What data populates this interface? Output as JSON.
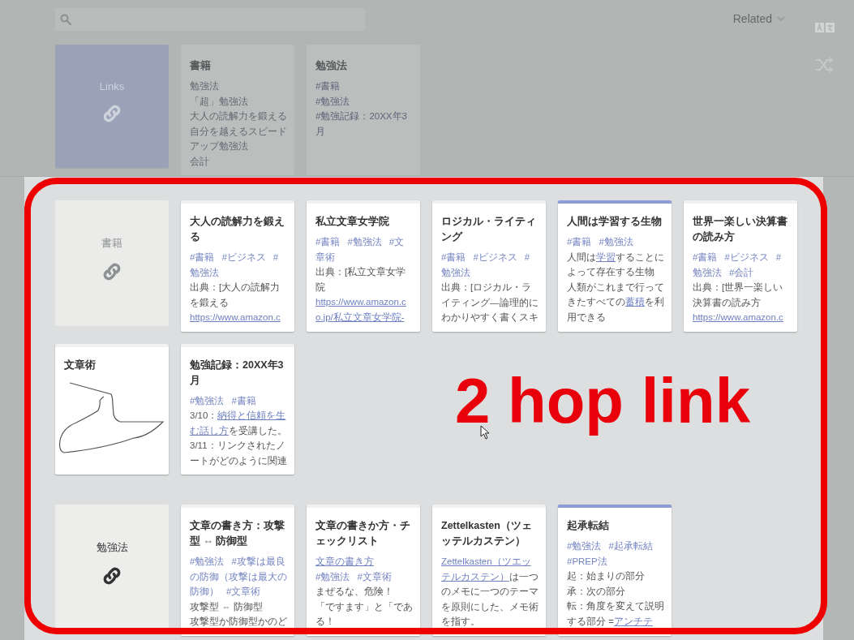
{
  "sort_menu": {
    "label": "Related"
  },
  "top_links": {
    "header": {
      "title": "Links",
      "kind": "links"
    },
    "cards": [
      {
        "title": "書籍",
        "kind": "text",
        "lines": [
          [
            {
              "text": "勉強法",
              "kind": "link"
            }
          ],
          [
            {
              "text": "「超」勉強法",
              "kind": "link"
            }
          ],
          [
            {
              "text": "大人の読解力を鍛える",
              "kind": "link"
            }
          ],
          [
            {
              "text": "自分を越えるスピード",
              "kind": "link"
            }
          ],
          [
            {
              "text": "アップ勉強法",
              "kind": "link"
            }
          ],
          [
            {
              "text": "会計",
              "kind": "link"
            }
          ]
        ]
      },
      {
        "title": "勉強法",
        "kind": "text",
        "lines": [
          [
            {
              "text": "#書籍",
              "kind": "tag"
            }
          ],
          [
            {
              "text": "#勉強法",
              "kind": "tag"
            }
          ],
          [
            {
              "text": "#勉強記録：20XX年3",
              "kind": "tag"
            }
          ],
          [
            {
              "text": "月",
              "kind": "tag"
            }
          ]
        ]
      }
    ]
  },
  "groups": [
    {
      "header": {
        "title": "書籍",
        "kind": "faded"
      },
      "cards": [
        {
          "title": "大人の読解力を鍛える",
          "highlighted": false,
          "kind": "text",
          "lines": [
            [
              {
                "text": "#書籍",
                "kind": "tag"
              },
              {
                "text": "#ビジネス",
                "kind": "tag"
              },
              {
                "text": "#",
                "kind": "tag"
              }
            ],
            [
              {
                "text": "勉強法",
                "kind": "tag"
              }
            ],
            [
              {
                "text": "出典：[大人の読解力",
                "kind": "text"
              }
            ],
            [
              {
                "text": "を鍛える",
                "kind": "text"
              }
            ],
            [
              {
                "text": "https://www.amazon.c",
                "kind": "link"
              }
            ]
          ]
        },
        {
          "title": "私立文章女学院",
          "highlighted": false,
          "kind": "text",
          "lines": [
            [
              {
                "text": "#書籍",
                "kind": "tag"
              },
              {
                "text": "#勉強法",
                "kind": "tag"
              },
              {
                "text": "#文",
                "kind": "tag"
              }
            ],
            [
              {
                "text": "章術",
                "kind": "tag"
              }
            ],
            [
              {
                "text": "出典：[私立文章女学",
                "kind": "text"
              }
            ],
            [
              {
                "text": "院",
                "kind": "text"
              }
            ],
            [
              {
                "text": "https://www.amazon.c",
                "kind": "link"
              }
            ],
            [
              {
                "text": "o.jp/私立文章女学院-",
                "kind": "link"
              }
            ]
          ]
        },
        {
          "title": "ロジカル・ライティング",
          "highlighted": false,
          "kind": "text",
          "lines": [
            [
              {
                "text": "#書籍",
                "kind": "tag"
              },
              {
                "text": "#ビジネス",
                "kind": "tag"
              },
              {
                "text": "#",
                "kind": "tag"
              }
            ],
            [
              {
                "text": "勉強法",
                "kind": "tag"
              }
            ],
            [
              {
                "text": "出典：[ロジカル・ラ",
                "kind": "text"
              }
            ],
            [
              {
                "text": "イティング―論理的に",
                "kind": "text"
              }
            ],
            [
              {
                "text": "わかりやすく書くスキ",
                "kind": "text"
              }
            ]
          ]
        },
        {
          "title": "人間は学習する生物",
          "highlighted": true,
          "kind": "text",
          "lines": [
            [
              {
                "text": "#書籍",
                "kind": "tag"
              },
              {
                "text": "#勉強法",
                "kind": "tag"
              }
            ],
            [
              {
                "text": "人間は",
                "kind": "text"
              },
              {
                "text": "学習",
                "kind": "link"
              },
              {
                "text": "することに",
                "kind": "text"
              }
            ],
            [
              {
                "text": "よって存在する生物",
                "kind": "text"
              }
            ],
            [
              {
                "text": "人類がこれまで行って",
                "kind": "text"
              }
            ],
            [
              {
                "text": "きたすべての",
                "kind": "text"
              },
              {
                "text": "蓄積",
                "kind": "link"
              },
              {
                "text": "を利",
                "kind": "text"
              }
            ],
            [
              {
                "text": "用できる",
                "kind": "text"
              }
            ]
          ]
        },
        {
          "title": "世界一楽しい決算書の読み方",
          "highlighted": false,
          "kind": "text",
          "lines": [
            [
              {
                "text": "#書籍",
                "kind": "tag"
              },
              {
                "text": "#ビジネス",
                "kind": "tag"
              },
              {
                "text": "#",
                "kind": "tag"
              }
            ],
            [
              {
                "text": "勉強法",
                "kind": "tag"
              },
              {
                "text": "#会計",
                "kind": "tag"
              }
            ],
            [
              {
                "text": "出典：[世界一楽しい",
                "kind": "text"
              }
            ],
            [
              {
                "text": "決算書の読み方",
                "kind": "text"
              }
            ],
            [
              {
                "text": "https://www.amazon.c",
                "kind": "link"
              }
            ]
          ]
        },
        {
          "title": "文章術",
          "highlighted": false,
          "kind": "drawing"
        },
        {
          "title": "勉強記録：20XX年3月",
          "highlighted": false,
          "kind": "text",
          "lines": [
            [
              {
                "text": "#勉強法",
                "kind": "tag"
              },
              {
                "text": "#書籍",
                "kind": "tag"
              }
            ],
            [
              {
                "text": "3/10：",
                "kind": "text"
              },
              {
                "text": "納得と信頼を生",
                "kind": "link"
              }
            ],
            [
              {
                "text": "む話し方",
                "kind": "link"
              },
              {
                "text": "を受講した。",
                "kind": "text"
              }
            ],
            [
              {
                "text": "3/11：リンクされたノ",
                "kind": "text"
              }
            ],
            [
              {
                "text": "ートがどのように関連",
                "kind": "text"
              }
            ]
          ]
        }
      ]
    },
    {
      "header": {
        "title": "勉強法",
        "kind": "plain"
      },
      "cards": [
        {
          "title": "文章の書き方：攻撃型 ⇔ 防御型",
          "highlighted": false,
          "kind": "text",
          "lines": [
            [
              {
                "text": "#勉強法",
                "kind": "tag"
              },
              {
                "text": "#攻撃は最良",
                "kind": "tag"
              }
            ],
            [
              {
                "text": "の防御（攻撃は最大の",
                "kind": "tag"
              }
            ],
            [
              {
                "text": "防御）",
                "kind": "tag"
              },
              {
                "text": "#文章術",
                "kind": "tag"
              }
            ],
            [
              {
                "text": "攻撃型 ⇔ 防御型",
                "kind": "text"
              }
            ],
            [
              {
                "text": "攻撃型か防御型かのど",
                "kind": "text"
              }
            ]
          ]
        },
        {
          "title": "文章の書きか方・チェックリスト",
          "highlighted": false,
          "kind": "text",
          "lines": [
            [
              {
                "text": "文章の書き方",
                "kind": "link"
              }
            ],
            [
              {
                "text": "#勉強法",
                "kind": "tag"
              },
              {
                "text": "#文章術",
                "kind": "tag"
              }
            ],
            [
              {
                "text": "まぜるな、危険！",
                "kind": "text"
              }
            ],
            [
              {
                "text": "「ですます」と「であ",
                "kind": "text"
              }
            ],
            [
              {
                "text": "る！",
                "kind": "text"
              }
            ]
          ]
        },
        {
          "title": "Zettelkasten（ツェッテルカステン）",
          "highlighted": false,
          "kind": "text",
          "lines": [
            [
              {
                "text": "Zettelkasten（ツエッ",
                "kind": "link"
              }
            ],
            [
              {
                "text": "テルカステン）",
                "kind": "link"
              },
              {
                "text": "は一つ",
                "kind": "text"
              }
            ],
            [
              {
                "text": "のメモに一つのテーマ",
                "kind": "text"
              }
            ],
            [
              {
                "text": "を原則にした、メモ術",
                "kind": "text"
              }
            ],
            [
              {
                "text": "を指す。",
                "kind": "text"
              }
            ]
          ]
        },
        {
          "title": "起承転結",
          "highlighted": true,
          "kind": "text",
          "lines": [
            [
              {
                "text": "#勉強法",
                "kind": "tag"
              },
              {
                "text": "#起承転結",
                "kind": "tag"
              }
            ],
            [
              {
                "text": "#PREP法",
                "kind": "tag"
              }
            ],
            [
              {
                "text": "起：始まりの部分",
                "kind": "text"
              }
            ],
            [
              {
                "text": "承：次の部分",
                "kind": "text"
              }
            ],
            [
              {
                "text": "転：角度を変えて説明",
                "kind": "text"
              }
            ],
            [
              {
                "text": "する部分 = ",
                "kind": "text"
              },
              {
                "text": "アンチテ",
                "kind": "link"
              }
            ]
          ]
        }
      ]
    }
  ],
  "annotation": {
    "text": "2 hop link"
  }
}
